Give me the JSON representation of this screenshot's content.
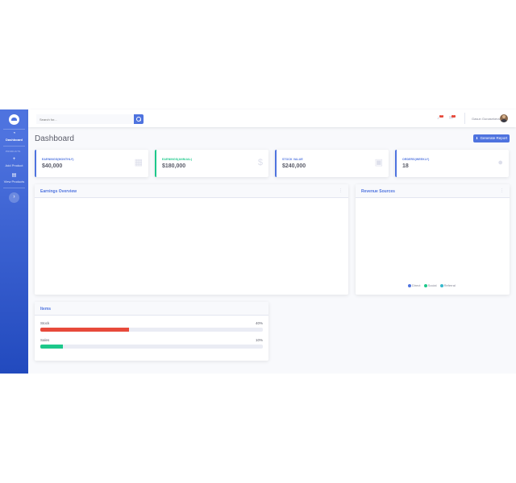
{
  "sidebar": {
    "brand_icon": "logo-icon",
    "items": [
      {
        "label": "Dashboard",
        "icon": "dashboard-icon"
      },
      {
        "label": "Add Product",
        "icon": "plus-icon"
      },
      {
        "label": "View Products",
        "icon": "table-icon"
      }
    ],
    "heading": "PRODUCTS",
    "toggle_glyph": "›"
  },
  "topbar": {
    "search_placeholder": "Search for...",
    "alerts_badge": "3+",
    "messages_badge": "7",
    "user_name": "Gasun Gunasekera"
  },
  "page": {
    "title": "Dashboard",
    "report_button": "Generate Report"
  },
  "stats": [
    {
      "label": "EARNINGS(MONTHLY)",
      "value": "$40,000",
      "color": "#4e73df",
      "icon": "calendar-icon"
    },
    {
      "label": "EARNINGS(ANNUAL)",
      "value": "$180,000",
      "color": "#1cc88a",
      "icon": "dollar-icon"
    },
    {
      "label": "STOCK VALUE",
      "value": "$240,000",
      "color": "#4e73df",
      "icon": "clipboard-icon"
    },
    {
      "label": "ORDERS(WEEKLY)",
      "value": "18",
      "color": "#4e73df",
      "icon": "comments-icon"
    }
  ],
  "earnings_panel": {
    "title": "Earnings Overview"
  },
  "revenue_panel": {
    "title": "Revenue Sources",
    "legend": [
      {
        "label": "Direct",
        "color": "#4e73df"
      },
      {
        "label": "Social",
        "color": "#1cc88a"
      },
      {
        "label": "Referral",
        "color": "#36b9cc"
      }
    ]
  },
  "items_panel": {
    "title": "Items",
    "rows": [
      {
        "label": "Stock",
        "pct_text": "40%",
        "fraction": 0.4,
        "color": "#e74a3b"
      },
      {
        "label": "Sales",
        "pct_text": "10%",
        "fraction": 0.1,
        "color": "#1cc88a"
      }
    ]
  }
}
